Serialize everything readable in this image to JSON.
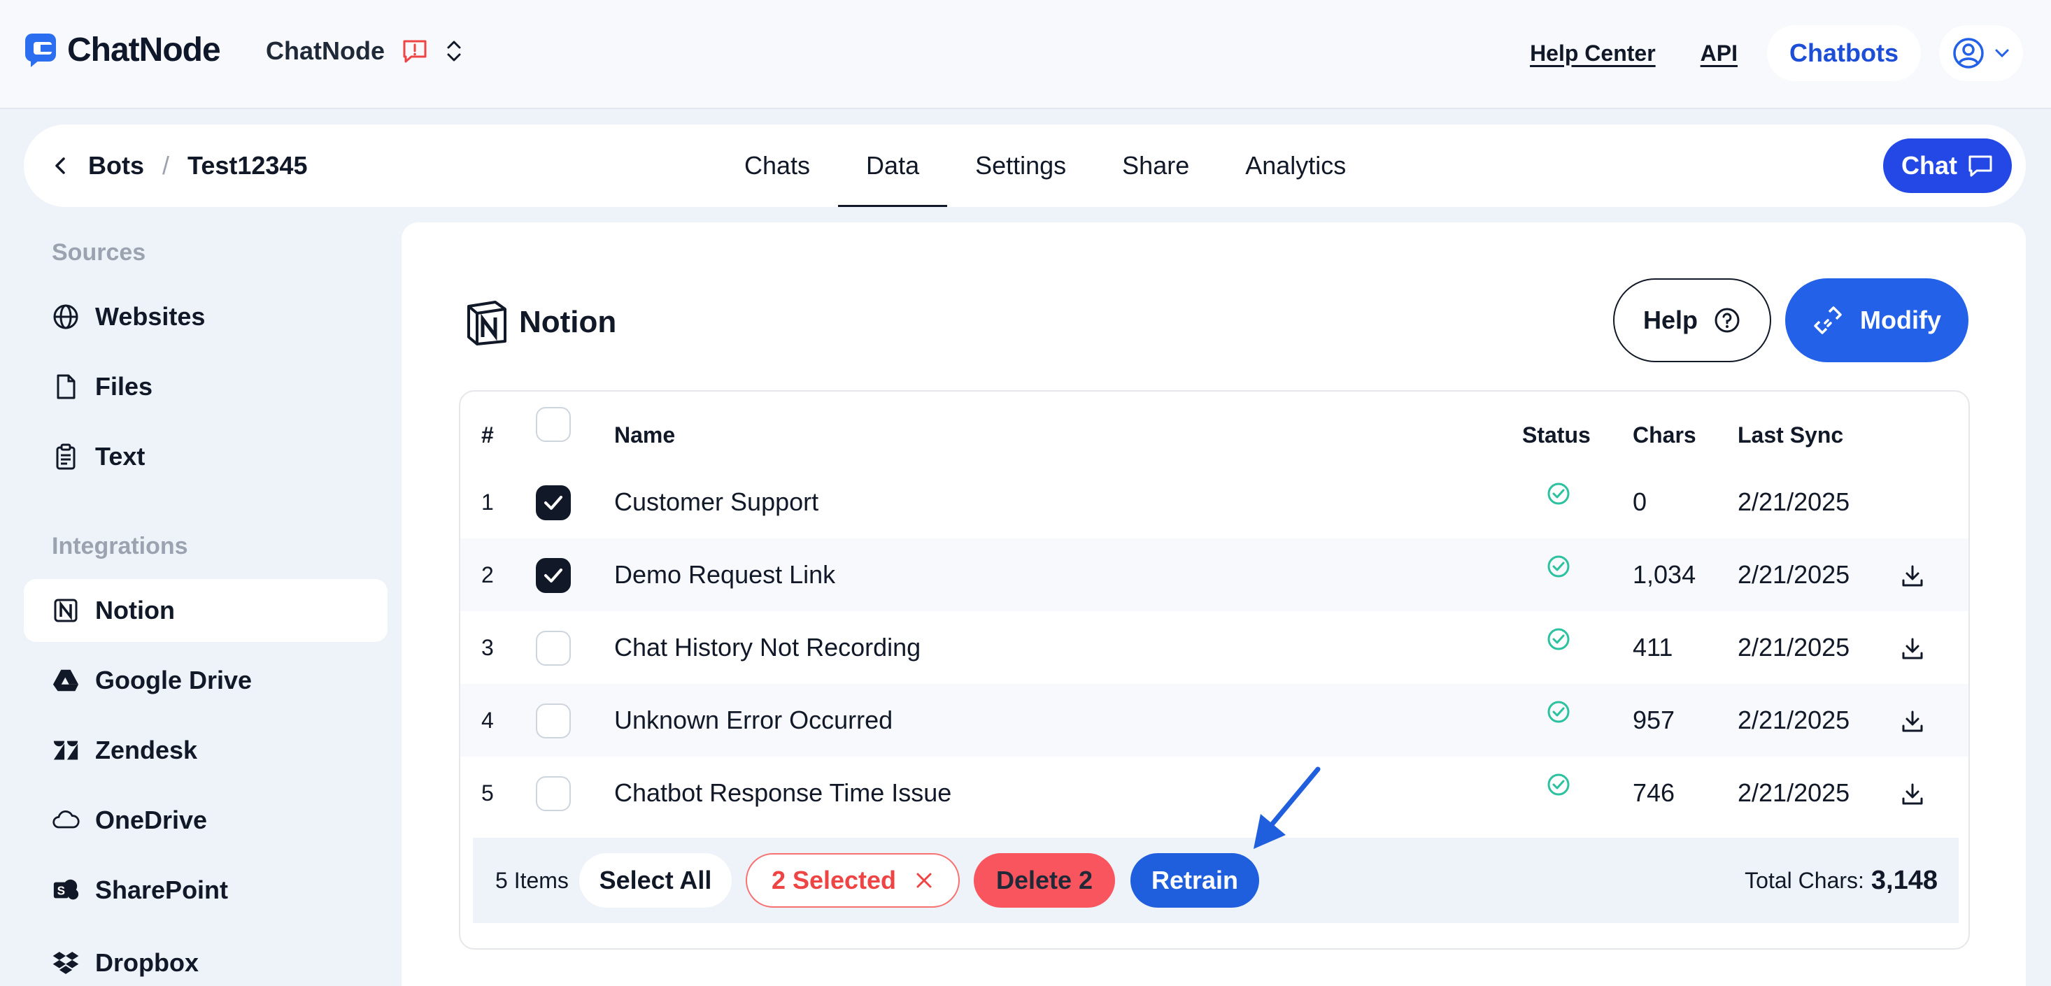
{
  "header": {
    "app_name": "ChatNode",
    "workspace": "ChatNode",
    "links": [
      "Help Center",
      "API"
    ],
    "chatbots_label": "Chatbots"
  },
  "breadcrumb": {
    "parent": "Bots",
    "sep": "/",
    "current": "Test12345"
  },
  "tabs": [
    {
      "label": "Chats",
      "active": false
    },
    {
      "label": "Data",
      "active": true
    },
    {
      "label": "Settings",
      "active": false
    },
    {
      "label": "Share",
      "active": false
    },
    {
      "label": "Analytics",
      "active": false
    }
  ],
  "chat_button": "Chat",
  "sidebar": {
    "sources_heading": "Sources",
    "sources": [
      {
        "label": "Websites",
        "icon": "globe-icon"
      },
      {
        "label": "Files",
        "icon": "file-icon"
      },
      {
        "label": "Text",
        "icon": "clipboard-icon"
      }
    ],
    "integrations_heading": "Integrations",
    "integrations": [
      {
        "label": "Notion",
        "icon": "notion-icon",
        "active": true
      },
      {
        "label": "Google Drive",
        "icon": "google-drive-icon"
      },
      {
        "label": "Zendesk",
        "icon": "zendesk-icon"
      },
      {
        "label": "OneDrive",
        "icon": "cloud-icon"
      },
      {
        "label": "SharePoint",
        "icon": "sharepoint-icon"
      },
      {
        "label": "Dropbox",
        "icon": "dropbox-icon"
      }
    ]
  },
  "panel": {
    "title": "Notion",
    "help_label": "Help",
    "modify_label": "Modify"
  },
  "table": {
    "headers": {
      "num": "#",
      "name": "Name",
      "status": "Status",
      "chars": "Chars",
      "last_sync": "Last Sync"
    },
    "rows": [
      {
        "num": "1",
        "name": "Customer Support",
        "chars": "0",
        "last_sync": "2/21/2025",
        "checked": true,
        "download": false
      },
      {
        "num": "2",
        "name": "Demo Request Link",
        "chars": "1,034",
        "last_sync": "2/21/2025",
        "checked": true,
        "download": true
      },
      {
        "num": "3",
        "name": "Chat History Not Recording",
        "chars": "411",
        "last_sync": "2/21/2025",
        "checked": false,
        "download": true
      },
      {
        "num": "4",
        "name": "Unknown Error Occurred",
        "chars": "957",
        "last_sync": "2/21/2025",
        "checked": false,
        "download": true
      },
      {
        "num": "5",
        "name": "Chatbot Response Time Issue",
        "chars": "746",
        "last_sync": "2/21/2025",
        "checked": false,
        "download": true
      }
    ]
  },
  "footer": {
    "items_count": "5 Items",
    "select_all": "Select All",
    "selected": "2 Selected",
    "delete": "Delete 2",
    "retrain": "Retrain",
    "total_label": "Total Chars:",
    "total_value": "3,148"
  },
  "colors": {
    "accent": "#2361e8",
    "danger": "#f8555e",
    "status_ok": "#2cc2a0"
  }
}
